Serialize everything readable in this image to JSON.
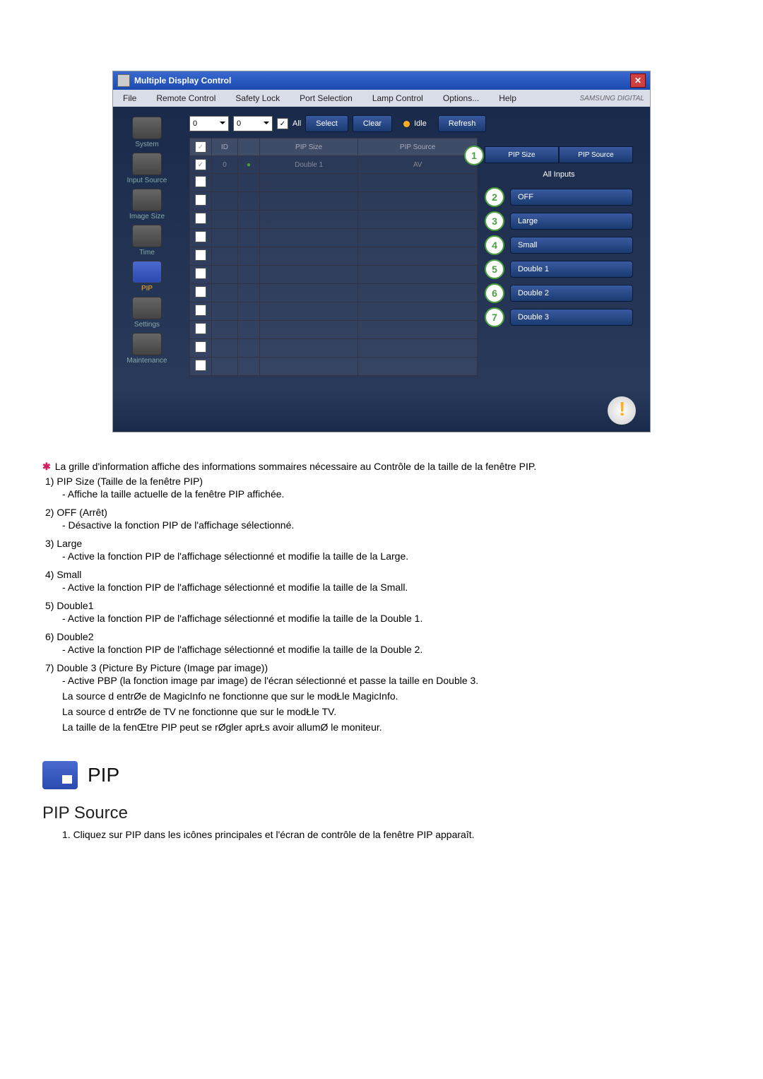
{
  "window": {
    "title": "Multiple Display Control",
    "menu": [
      "File",
      "Remote Control",
      "Safety Lock",
      "Port Selection",
      "Lamp Control",
      "Options...",
      "Help"
    ],
    "brand": "SAMSUNG DIGITAL"
  },
  "sidebar": {
    "items": [
      {
        "label": "System"
      },
      {
        "label": "Input Source"
      },
      {
        "label": "Image Size"
      },
      {
        "label": "Time"
      },
      {
        "label": "PIP"
      },
      {
        "label": "Settings"
      },
      {
        "label": "Maintenance"
      }
    ]
  },
  "toprow": {
    "dd1": "0",
    "dd2": "0",
    "all": "All",
    "select": "Select",
    "clear": "Clear",
    "idle": "Idle",
    "refresh": "Refresh"
  },
  "table": {
    "headers": [
      "",
      "ID",
      "",
      "PIP Size",
      "PIP Source"
    ],
    "rows": [
      {
        "chk": true,
        "id": "0",
        "stat": "●",
        "size": "Double 1",
        "src": "AV"
      },
      {
        "chk": false,
        "id": "",
        "stat": "",
        "size": "",
        "src": ""
      }
    ],
    "blank_rows": 10
  },
  "right": {
    "pip_size": "PIP Size",
    "pip_source": "PIP Source",
    "all_inputs": "All Inputs",
    "buttons": [
      {
        "n": "1",
        "label": ""
      },
      {
        "n": "2",
        "label": "OFF"
      },
      {
        "n": "3",
        "label": "Large"
      },
      {
        "n": "4",
        "label": "Small"
      },
      {
        "n": "5",
        "label": "Double 1"
      },
      {
        "n": "6",
        "label": "Double 2"
      },
      {
        "n": "7",
        "label": "Double 3"
      }
    ]
  },
  "doc": {
    "intro": "La grille d'information affiche des informations sommaires nécessaire au Contrôle de la taille de la fenêtre PIP.",
    "items": [
      {
        "h": "1)  PIP Size (Taille de la fenêtre PIP)",
        "s": "- Affiche la taille actuelle de la fenêtre PIP affichée."
      },
      {
        "h": "2)  OFF (Arrêt)",
        "s": "- Désactive la fonction PIP de l'affichage sélectionné."
      },
      {
        "h": "3)  Large",
        "s": "- Active la fonction PIP de l'affichage sélectionné et modifie la taille de la Large."
      },
      {
        "h": "4)  Small",
        "s": "- Active la fonction PIP de l'affichage sélectionné et modifie la taille de la Small."
      },
      {
        "h": "5)  Double1",
        "s": "- Active la fonction PIP de l'affichage sélectionné et modifie la taille de la Double 1."
      },
      {
        "h": "6)  Double2",
        "s": "- Active la fonction PIP de l'affichage sélectionné et modifie la taille de la Double 2."
      },
      {
        "h": "7)  Double 3 (Picture By Picture (Image par image))",
        "s": "- Active PBP (la fonction image par image) de l'écran sélectionné et passe la taille en Double 3."
      }
    ],
    "notes": [
      "La source d entrØe de MagicInfo ne fonctionne que sur le modŁle MagicInfo.",
      "La source d entrØe de TV ne fonctionne que sur le modŁle TV.",
      "La taille de la fenŒtre PIP peut se rØgler aprŁs avoir allumØ le moniteur."
    ],
    "h2": "PIP",
    "h3": "PIP Source",
    "last": "1.  Cliquez sur PIP dans les icônes principales et l'écran de contrôle de la fenêtre PIP apparaît."
  }
}
